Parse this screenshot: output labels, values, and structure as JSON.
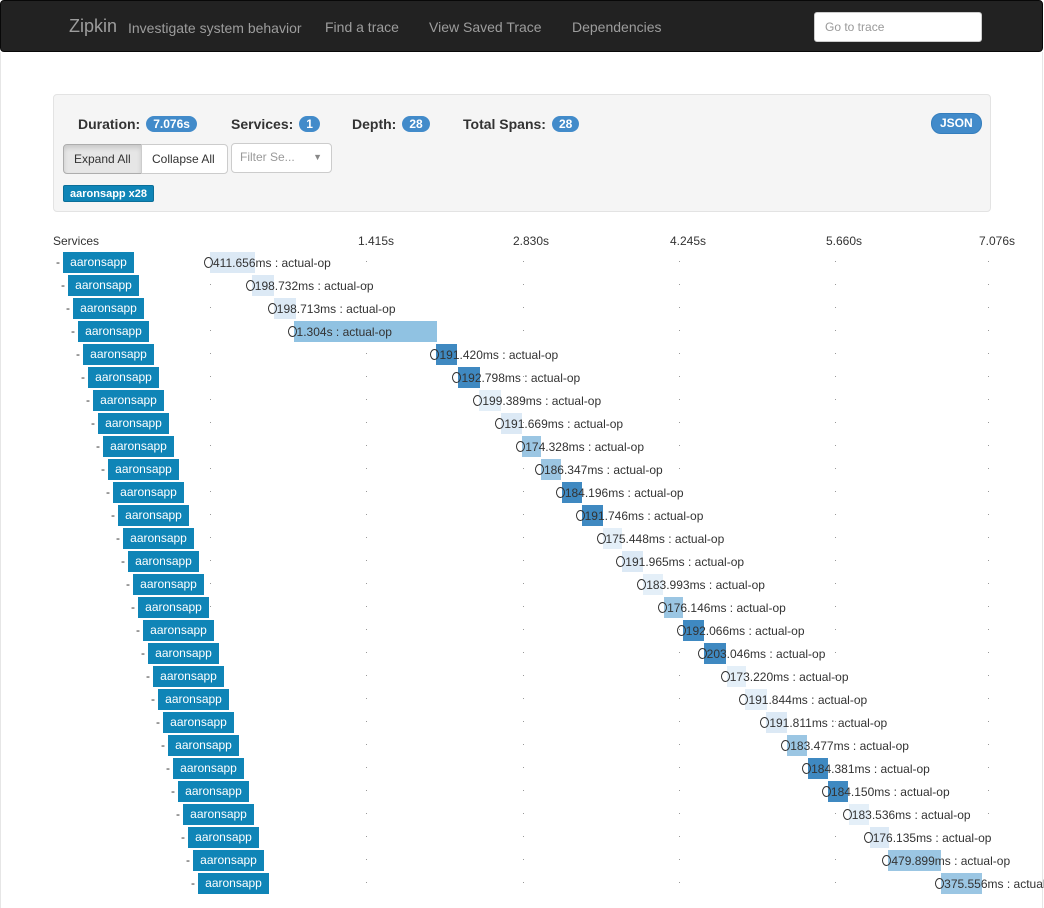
{
  "nav": {
    "brand": "Zipkin",
    "tagline": "Investigate system behavior",
    "links": [
      "Find a trace",
      "View Saved Trace",
      "Dependencies"
    ],
    "goto_placeholder": "Go to trace"
  },
  "summary": {
    "duration_label": "Duration:",
    "duration": "7.076s",
    "services_label": "Services:",
    "services": "1",
    "depth_label": "Depth:",
    "depth": "28",
    "total_spans_label": "Total Spans:",
    "total_spans": "28",
    "json_label": "JSON"
  },
  "controls": {
    "expand_all": "Expand All",
    "collapse_all": "Collapse All",
    "filter_placeholder": "Filter Se...",
    "service_badge": "aaronsapp x28"
  },
  "timeline": {
    "services_label": "Services",
    "ticks": [
      "1.415s",
      "2.830s",
      "4.245s",
      "5.660s",
      "7.076s"
    ],
    "total_seconds": 7.076
  },
  "spans": [
    {
      "service": "aaronsapp",
      "duration": "411.656ms",
      "name": "actual-op",
      "start_s": 0.0,
      "dur_s": 0.412,
      "shade": "#dce9f5"
    },
    {
      "service": "aaronsapp",
      "duration": "198.732ms",
      "name": "actual-op",
      "start_s": 0.38,
      "dur_s": 0.199,
      "shade": "#dce9f5"
    },
    {
      "service": "aaronsapp",
      "duration": "198.713ms",
      "name": "actual-op",
      "start_s": 0.58,
      "dur_s": 0.199,
      "shade": "#dce9f5"
    },
    {
      "service": "aaronsapp",
      "duration": "1.304s",
      "name": "actual-op",
      "start_s": 0.76,
      "dur_s": 1.304,
      "shade": "#90c2e2"
    },
    {
      "service": "aaronsapp",
      "duration": "191.420ms",
      "name": "actual-op",
      "start_s": 2.06,
      "dur_s": 0.191,
      "shade": "#3f89c1"
    },
    {
      "service": "aaronsapp",
      "duration": "192.798ms",
      "name": "actual-op",
      "start_s": 2.26,
      "dur_s": 0.193,
      "shade": "#3f89c1"
    },
    {
      "service": "aaronsapp",
      "duration": "199.389ms",
      "name": "actual-op",
      "start_s": 2.45,
      "dur_s": 0.199,
      "shade": "#e4eff8"
    },
    {
      "service": "aaronsapp",
      "duration": "191.669ms",
      "name": "actual-op",
      "start_s": 2.65,
      "dur_s": 0.192,
      "shade": "#dce9f5"
    },
    {
      "service": "aaronsapp",
      "duration": "174.328ms",
      "name": "actual-op",
      "start_s": 2.84,
      "dur_s": 0.174,
      "shade": "#9bc6e3"
    },
    {
      "service": "aaronsapp",
      "duration": "186.347ms",
      "name": "actual-op",
      "start_s": 3.01,
      "dur_s": 0.186,
      "shade": "#9bc6e3"
    },
    {
      "service": "aaronsapp",
      "duration": "184.196ms",
      "name": "actual-op",
      "start_s": 3.2,
      "dur_s": 0.184,
      "shade": "#3f89c1"
    },
    {
      "service": "aaronsapp",
      "duration": "191.746ms",
      "name": "actual-op",
      "start_s": 3.38,
      "dur_s": 0.192,
      "shade": "#3f89c1"
    },
    {
      "service": "aaronsapp",
      "duration": "175.448ms",
      "name": "actual-op",
      "start_s": 3.57,
      "dur_s": 0.175,
      "shade": "#e4eff8"
    },
    {
      "service": "aaronsapp",
      "duration": "191.965ms",
      "name": "actual-op",
      "start_s": 3.75,
      "dur_s": 0.192,
      "shade": "#dce9f5"
    },
    {
      "service": "aaronsapp",
      "duration": "183.993ms",
      "name": "actual-op",
      "start_s": 3.94,
      "dur_s": 0.184,
      "shade": "#e4eff8"
    },
    {
      "service": "aaronsapp",
      "duration": "176.146ms",
      "name": "actual-op",
      "start_s": 4.13,
      "dur_s": 0.176,
      "shade": "#9bc6e3"
    },
    {
      "service": "aaronsapp",
      "duration": "192.066ms",
      "name": "actual-op",
      "start_s": 4.3,
      "dur_s": 0.192,
      "shade": "#3f89c1"
    },
    {
      "service": "aaronsapp",
      "duration": "203.046ms",
      "name": "actual-op",
      "start_s": 4.49,
      "dur_s": 0.203,
      "shade": "#3f89c1"
    },
    {
      "service": "aaronsapp",
      "duration": "173.220ms",
      "name": "actual-op",
      "start_s": 4.7,
      "dur_s": 0.173,
      "shade": "#e4eff8"
    },
    {
      "service": "aaronsapp",
      "duration": "191.844ms",
      "name": "actual-op",
      "start_s": 4.87,
      "dur_s": 0.192,
      "shade": "#e4eff8"
    },
    {
      "service": "aaronsapp",
      "duration": "191.811ms",
      "name": "actual-op",
      "start_s": 5.06,
      "dur_s": 0.192,
      "shade": "#dce9f5"
    },
    {
      "service": "aaronsapp",
      "duration": "183.477ms",
      "name": "actual-op",
      "start_s": 5.25,
      "dur_s": 0.183,
      "shade": "#9bc6e3"
    },
    {
      "service": "aaronsapp",
      "duration": "184.381ms",
      "name": "actual-op",
      "start_s": 5.44,
      "dur_s": 0.184,
      "shade": "#3f89c1"
    },
    {
      "service": "aaronsapp",
      "duration": "184.150ms",
      "name": "actual-op",
      "start_s": 5.62,
      "dur_s": 0.184,
      "shade": "#3f89c1"
    },
    {
      "service": "aaronsapp",
      "duration": "183.536ms",
      "name": "actual-op",
      "start_s": 5.81,
      "dur_s": 0.184,
      "shade": "#e4eff8"
    },
    {
      "service": "aaronsapp",
      "duration": "176.135ms",
      "name": "actual-op",
      "start_s": 6.0,
      "dur_s": 0.176,
      "shade": "#dce9f5"
    },
    {
      "service": "aaronsapp",
      "duration": "479.899ms",
      "name": "actual-op",
      "start_s": 6.17,
      "dur_s": 0.48,
      "shade": "#9bc6e3"
    },
    {
      "service": "aaronsapp",
      "duration": "375.556ms",
      "name": "actual-op",
      "start_s": 6.65,
      "dur_s": 0.376,
      "shade": "#9bc6e3"
    }
  ]
}
